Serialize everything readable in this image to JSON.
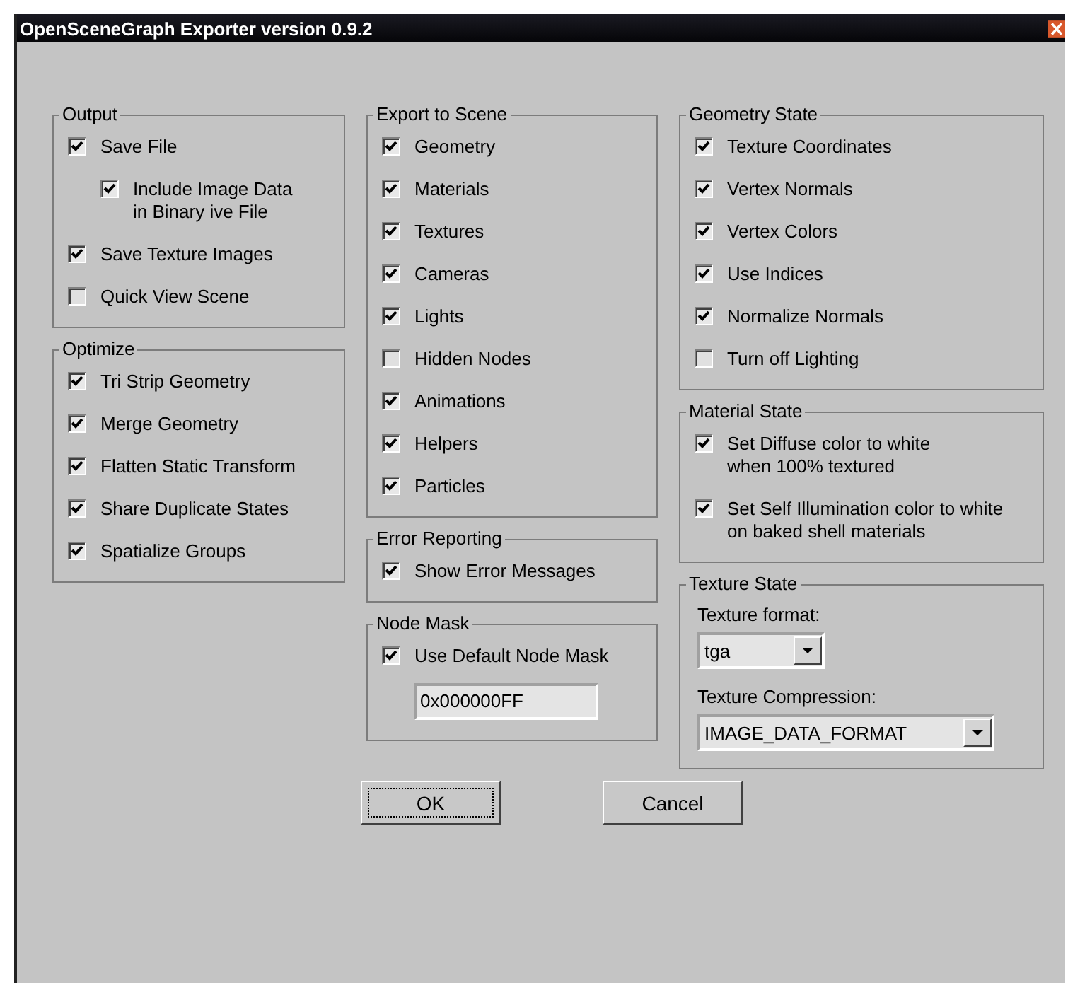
{
  "window": {
    "title": "OpenSceneGraph Exporter version 0.9.2"
  },
  "columns": [
    [
      {
        "title": "Output",
        "items": [
          {
            "kind": "checkbox",
            "lines": [
              "Save File"
            ],
            "checked": true,
            "children": [
              {
                "kind": "checkbox",
                "lines": [
                  "Include Image Data",
                  "in Binary ive File"
                ],
                "checked": true
              }
            ]
          },
          {
            "kind": "checkbox",
            "lines": [
              "Save Texture Images"
            ],
            "checked": true
          },
          {
            "kind": "checkbox",
            "lines": [
              "Quick View Scene"
            ],
            "checked": false
          }
        ]
      },
      {
        "title": "Optimize",
        "items": [
          {
            "kind": "checkbox",
            "lines": [
              "Tri Strip Geometry"
            ],
            "checked": true
          },
          {
            "kind": "checkbox",
            "lines": [
              "Merge Geometry"
            ],
            "checked": true
          },
          {
            "kind": "checkbox",
            "lines": [
              "Flatten Static Transform"
            ],
            "checked": true
          },
          {
            "kind": "checkbox",
            "lines": [
              "Share Duplicate States"
            ],
            "checked": true
          },
          {
            "kind": "checkbox",
            "lines": [
              "Spatialize Groups"
            ],
            "checked": true
          }
        ]
      }
    ],
    [
      {
        "title": "Export to Scene",
        "items": [
          {
            "kind": "checkbox",
            "lines": [
              "Geometry"
            ],
            "checked": true
          },
          {
            "kind": "checkbox",
            "lines": [
              "Materials"
            ],
            "checked": true
          },
          {
            "kind": "checkbox",
            "lines": [
              "Textures"
            ],
            "checked": true
          },
          {
            "kind": "checkbox",
            "lines": [
              "Cameras"
            ],
            "checked": true
          },
          {
            "kind": "checkbox",
            "lines": [
              "Lights"
            ],
            "checked": true
          },
          {
            "kind": "checkbox",
            "lines": [
              "Hidden Nodes"
            ],
            "checked": false
          },
          {
            "kind": "checkbox",
            "lines": [
              "Animations"
            ],
            "checked": true
          },
          {
            "kind": "checkbox",
            "lines": [
              "Helpers"
            ],
            "checked": true
          },
          {
            "kind": "checkbox",
            "lines": [
              "Particles"
            ],
            "checked": true
          }
        ]
      },
      {
        "title": "Error Reporting",
        "items": [
          {
            "kind": "checkbox",
            "lines": [
              "Show Error Messages"
            ],
            "checked": true
          }
        ]
      },
      {
        "title": "Node Mask",
        "items": [
          {
            "kind": "checkbox",
            "lines": [
              "Use Default Node Mask"
            ],
            "checked": true
          },
          {
            "kind": "text-field",
            "value": "0x000000FF"
          }
        ]
      }
    ],
    [
      {
        "title": "Geometry State",
        "items": [
          {
            "kind": "checkbox",
            "lines": [
              "Texture Coordinates"
            ],
            "checked": true
          },
          {
            "kind": "checkbox",
            "lines": [
              "Vertex Normals"
            ],
            "checked": true
          },
          {
            "kind": "checkbox",
            "lines": [
              "Vertex Colors"
            ],
            "checked": true
          },
          {
            "kind": "checkbox",
            "lines": [
              "Use Indices"
            ],
            "checked": true
          },
          {
            "kind": "checkbox",
            "lines": [
              "Normalize Normals"
            ],
            "checked": true
          },
          {
            "kind": "checkbox",
            "lines": [
              "Turn off Lighting"
            ],
            "checked": false
          }
        ]
      },
      {
        "title": "Material State",
        "items": [
          {
            "kind": "checkbox",
            "lines": [
              "Set Diffuse color to white",
              "when 100% textured"
            ],
            "checked": true
          },
          {
            "kind": "checkbox",
            "lines": [
              "Set Self Illumination color to white",
              "on baked shell materials"
            ],
            "checked": true
          }
        ]
      },
      {
        "title": "Texture State",
        "items": [
          {
            "kind": "label",
            "text": "Texture format:"
          },
          {
            "kind": "dropdown",
            "value": "tga"
          },
          {
            "kind": "label",
            "text": "Texture Compression:"
          },
          {
            "kind": "dropdown",
            "value": "IMAGE_DATA_FORMAT"
          }
        ]
      }
    ]
  ],
  "buttons": [
    {
      "label": "OK",
      "focused": true
    },
    {
      "label": "Cancel",
      "focused": false
    }
  ]
}
